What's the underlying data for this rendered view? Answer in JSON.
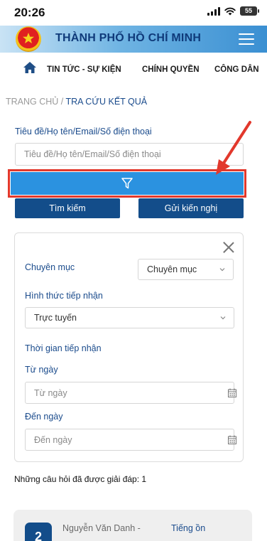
{
  "status_bar": {
    "time": "20:26",
    "battery": "55"
  },
  "header": {
    "title": "THÀNH PHỐ HỒ CHÍ MINH"
  },
  "nav": {
    "items": [
      "TIN TỨC - SỰ KIỆN",
      "CHÍNH QUYỀN",
      "CÔNG DÂN"
    ]
  },
  "breadcrumb": {
    "home": "TRANG CHỦ",
    "separator": " / ",
    "current": "TRA CỨU KẾT QUẢ"
  },
  "search": {
    "label": "Tiêu đề/Họ tên/Email/Số điện thoại",
    "placeholder": "Tiêu đề/Họ tên/Email/Số điện thoại",
    "value": ""
  },
  "actions": {
    "search_label": "Tìm kiếm",
    "submit_label": "Gửi kiến nghị"
  },
  "filters": {
    "category_label": "Chuyên mục",
    "category_value": "Chuyên mục",
    "method_label": "Hình thức tiếp nhận",
    "method_value": "Trực tuyến",
    "time_label": "Thời gian tiếp nhận",
    "from_label": "Từ ngày",
    "from_placeholder": "Từ ngày",
    "to_label": "Đến ngày",
    "to_placeholder": "Đến ngày"
  },
  "results": {
    "answered_text": "Những câu hỏi đã được giải đáp: 1"
  },
  "card": {
    "number": "2",
    "author": "Nguyễn Văn Danh -",
    "topic": "Tiếng ồn"
  },
  "colors": {
    "primary": "#134d8a",
    "accent": "#2b92e0",
    "highlight": "#e2382c",
    "link": "#1a4b8c"
  }
}
